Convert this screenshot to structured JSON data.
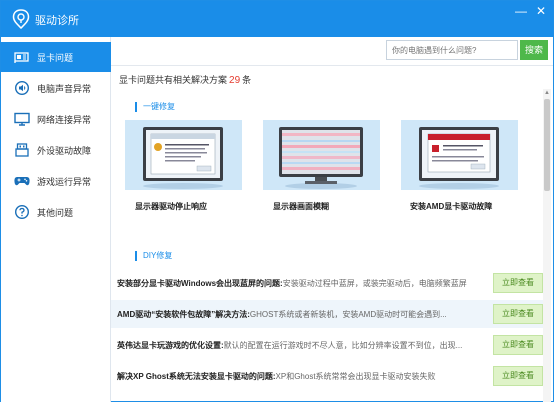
{
  "window": {
    "title": "驱动诊所",
    "minimize_glyph": "—",
    "close_glyph": "✕"
  },
  "sidebar": {
    "items": [
      {
        "label": "显卡问题",
        "icon": "graphics-card-icon",
        "active": true
      },
      {
        "label": "电脑声音异常",
        "icon": "speaker-icon",
        "active": false
      },
      {
        "label": "网络连接异常",
        "icon": "monitor-network-icon",
        "active": false
      },
      {
        "label": "外设驱动故障",
        "icon": "usb-device-icon",
        "active": false
      },
      {
        "label": "游戏运行异常",
        "icon": "gamepad-icon",
        "active": false
      },
      {
        "label": "其他问题",
        "icon": "help-circle-icon",
        "active": false
      }
    ]
  },
  "search": {
    "placeholder": "你的电脑遇到什么问题?",
    "button_label": "搜索"
  },
  "summary": {
    "prefix": "显卡问题共有相关解决方案",
    "count": "29",
    "suffix": "条"
  },
  "quick_fix": {
    "title": "一键修复",
    "cards": [
      {
        "caption": "显示器驱动停止响应",
        "icon": "driver-error-dialog-icon"
      },
      {
        "caption": "显示器画面模糊",
        "icon": "blurry-monitor-icon"
      },
      {
        "caption": "安装AMD显卡驱动故障",
        "icon": "amd-install-error-icon"
      }
    ]
  },
  "diy_fix": {
    "title": "DIY修复",
    "action_label": "立即查看",
    "rows": [
      {
        "title": "安装部分显卡驱动Windows会出现蓝屏的问题:",
        "desc": "安装驱动过程中蓝屏，或装完驱动后，电脑频繁蓝屏"
      },
      {
        "title": "AMD驱动“安装软件包故障”解决方法:",
        "desc": "GHOST系统或者新装机，安装AMD驱动时可能会遇到..."
      },
      {
        "title": "英伟达显卡玩游戏的优化设置:",
        "desc": "默认的配置在运行游戏时不尽人意，比如分辨率设置不到位，出现..."
      },
      {
        "title": "解决XP Ghost系统无法安装显卡驱动的问题:",
        "desc": "XP和Ghost系统常常会出现显卡驱动安装失败"
      }
    ]
  },
  "colors": {
    "accent": "#1a8de8",
    "search_button": "#4eb84a",
    "count": "#e43c2f",
    "action_bg": "#dff3c8"
  }
}
